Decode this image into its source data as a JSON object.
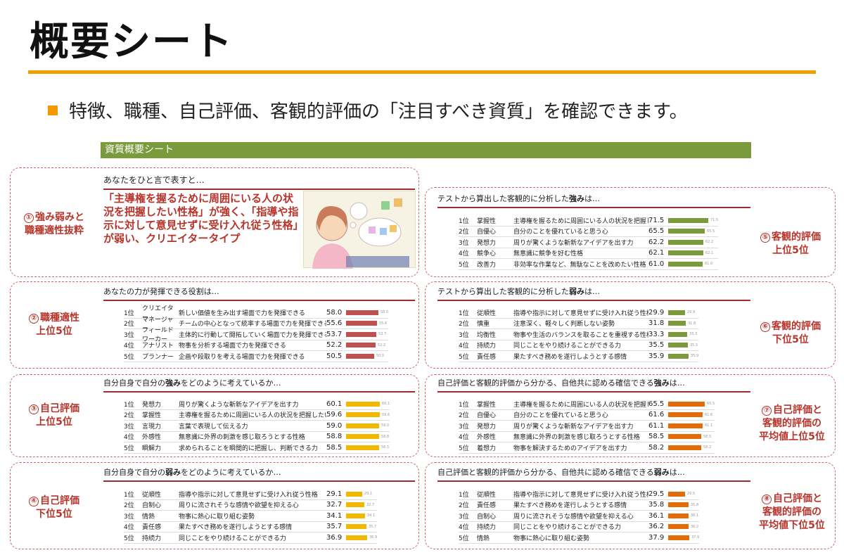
{
  "title": "概要シート",
  "bullet": "特徴、職種、自己評価、客観的評価の「注目すべき資質」を確認できます。",
  "banner": "資質概要シート",
  "colors": {
    "accent": "#f39800",
    "green": "#7a9a3c",
    "red_bar": "#c0504d",
    "yellow_bar": "#f2b800",
    "orange_bar": "#e36c0a",
    "label": "#b8342b"
  },
  "s1": {
    "num": "①",
    "label1": "強み弱みと",
    "label2": "職種適性抜粋",
    "heading": "あなたをひと言で表すと…",
    "quote": "「主導権を握るために周囲にいる人の状況を把握したい性格」が強く、「指導や指示に対して意見せずに受け入れ従う性格」が弱い、クリエイタータイプ",
    "illus_icon": "thinking-person-illustration"
  },
  "s2": {
    "num": "②",
    "label1": "職種適性",
    "label2": "上位5位",
    "heading": "あなたの力が発揮できる役割は…",
    "rows": [
      {
        "rank": "1位",
        "name": "クリエイター",
        "desc": "新しい価値を生み出す場面で力を発揮できる",
        "score": "58.0",
        "value": 58.0
      },
      {
        "rank": "2位",
        "name": "マネージャー",
        "desc": "チームの中心となって統率する場面で力を発揮できる",
        "score": "55.6",
        "value": 55.6
      },
      {
        "rank": "3位",
        "name": "フィールドワーカー",
        "desc": "主体的に行動して開拓していく場面で力を発揮できる",
        "score": "53.7",
        "value": 53.7
      },
      {
        "rank": "4位",
        "name": "アナリスト",
        "desc": "物事を分析する場面で力を発揮できる",
        "score": "52.2",
        "value": 52.2
      },
      {
        "rank": "5位",
        "name": "プランナー",
        "desc": "企画や段取りを考える場面で力を発揮できる",
        "score": "50.5",
        "value": 50.5
      }
    ]
  },
  "s3": {
    "num": "③",
    "label1": "自己評価",
    "label2": "上位5位",
    "heading_pre": "自分自身で自分の",
    "heading_em": "強み",
    "heading_post": "をどのように考えているか…",
    "rows": [
      {
        "rank": "1位",
        "name": "発想力",
        "desc": "周りが驚くような斬新なアイデアを出す力",
        "score": "60.1",
        "value": 60.1
      },
      {
        "rank": "2位",
        "name": "掌握性",
        "desc": "主導権を握るために周囲にいる人の状況を把握したい性格",
        "score": "59.6",
        "value": 59.6
      },
      {
        "rank": "3位",
        "name": "言現力",
        "desc": "言葉で表現して伝える力",
        "score": "59.0",
        "value": 59.0
      },
      {
        "rank": "4位",
        "name": "外感性",
        "desc": "無意識に外界の刺激を感じ取ろうとする性格",
        "score": "58.8",
        "value": 58.8
      },
      {
        "rank": "5位",
        "name": "瞬解力",
        "desc": "求められることを瞬間的に把握し、判断できる力",
        "score": "58.5",
        "value": 58.5
      }
    ]
  },
  "s4": {
    "num": "④",
    "label1": "自己評価",
    "label2": "下位5位",
    "heading_pre": "自分自身で自分の",
    "heading_em": "弱み",
    "heading_post": "をどのように考えているか…",
    "rows": [
      {
        "rank": "1位",
        "name": "従順性",
        "desc": "指導や指示に対して意見せずに受け入れ従う性格",
        "score": "29.1",
        "value": 29.1
      },
      {
        "rank": "2位",
        "name": "自制心",
        "desc": "周りに流されそうな感情や欲望を抑える心",
        "score": "32.7",
        "value": 32.7
      },
      {
        "rank": "3位",
        "name": "情熱",
        "desc": "物事に熱心に取り組む姿勢",
        "score": "34.1",
        "value": 34.1
      },
      {
        "rank": "4位",
        "name": "責任感",
        "desc": "果たすべき務めを遂行しようとする感情",
        "score": "35.7",
        "value": 35.7
      },
      {
        "rank": "5位",
        "name": "持続力",
        "desc": "同じことをやり続けることができる力",
        "score": "36.9",
        "value": 36.9
      }
    ]
  },
  "s5": {
    "num": "⑤",
    "label1": "客観的評価",
    "label2": "上位5位",
    "heading_pre": "テストから算出した客観的に分析した",
    "heading_em": "強み",
    "heading_post": "は…",
    "rows": [
      {
        "rank": "1位",
        "name": "掌握性",
        "desc": "主導権を握るために周囲にいる人の状況を把握したい性格",
        "score": "71.5",
        "value": 71.5
      },
      {
        "rank": "2位",
        "name": "自優心",
        "desc": "自分のことを優れていると思う心",
        "score": "65.5",
        "value": 65.5
      },
      {
        "rank": "3位",
        "name": "発想力",
        "desc": "周りが驚くような斬新なアイデアを出す力",
        "score": "62.2",
        "value": 62.2
      },
      {
        "rank": "4位",
        "name": "競争心",
        "desc": "無意識に競争を好む性格",
        "score": "62.1",
        "value": 62.1
      },
      {
        "rank": "5位",
        "name": "改善力",
        "desc": "非効率な作業など、無駄なことを改めたい性格",
        "score": "61.0",
        "value": 61.0
      }
    ]
  },
  "s6": {
    "num": "⑥",
    "label1": "客観的評価",
    "label2": "下位5位",
    "heading_pre": "テストから算出した客観的に分析した",
    "heading_em": "弱み",
    "heading_post": "は…",
    "rows": [
      {
        "rank": "1位",
        "name": "従順性",
        "desc": "指導や指示に対して意見せずに受け入れ従う性格",
        "score": "29.9",
        "value": 29.9
      },
      {
        "rank": "2位",
        "name": "慎重",
        "desc": "注意深く、軽々しく判断しない姿勢",
        "score": "31.8",
        "value": 31.8
      },
      {
        "rank": "3位",
        "name": "均衡性",
        "desc": "物事や生活のバランスを取ることを重視する性格",
        "score": "33.3",
        "value": 33.3
      },
      {
        "rank": "4位",
        "name": "持続力",
        "desc": "同じことをやり続けることができる力",
        "score": "35.5",
        "value": 35.5
      },
      {
        "rank": "5位",
        "name": "責任感",
        "desc": "果たすべき務めを遂行しようとする感情",
        "score": "35.9",
        "value": 35.9
      }
    ]
  },
  "s7": {
    "num": "⑦",
    "label1": "自己評価と",
    "label2": "客観的評価の",
    "label3": "平均値上位5位",
    "heading_pre": "自己評価と客観的評価から分かる、自他共に認める確信できる",
    "heading_em": "強み",
    "heading_post": "は…",
    "rows": [
      {
        "rank": "1位",
        "name": "掌握性",
        "desc": "主導権を握るために周囲にいる人の状況を把握したい性格",
        "score": "65.5",
        "value": 65.5
      },
      {
        "rank": "2位",
        "name": "自優心",
        "desc": "自分のことを優れていると思う心",
        "score": "61.6",
        "value": 61.6
      },
      {
        "rank": "3位",
        "name": "発想力",
        "desc": "周りが驚くような斬新なアイデアを出す力",
        "score": "61.1",
        "value": 61.1
      },
      {
        "rank": "4位",
        "name": "外感性",
        "desc": "無意識に外界の刺激を感じ取ろうとする性格",
        "score": "58.5",
        "value": 58.5
      },
      {
        "rank": "5位",
        "name": "着想力",
        "desc": "物事を解決するためのアイデアを出す力",
        "score": "58.2",
        "value": 58.2
      }
    ]
  },
  "s8": {
    "num": "⑧",
    "label1": "自己評価と",
    "label2": "客観的評価の",
    "label3": "平均値下位5位",
    "heading_pre": "自己評価と客観的評価から分かる、自他共に認める確信できる",
    "heading_em": "弱み",
    "heading_post": "は…",
    "rows": [
      {
        "rank": "1位",
        "name": "従順性",
        "desc": "指導や指示に対して意見せずに受け入れ従う性格",
        "score": "29.5",
        "value": 29.5
      },
      {
        "rank": "2位",
        "name": "責任感",
        "desc": "果たすべき務めを遂行しようとする感情",
        "score": "35.8",
        "value": 35.8
      },
      {
        "rank": "3位",
        "name": "自制心",
        "desc": "周りに流されそうな感情や欲望を抑える心",
        "score": "36.1",
        "value": 36.1
      },
      {
        "rank": "4位",
        "name": "持続力",
        "desc": "同じことをやり続けることができる力",
        "score": "36.2",
        "value": 36.2
      },
      {
        "rank": "5位",
        "name": "情熱",
        "desc": "物事に熱心に取り組む姿勢",
        "score": "37.9",
        "value": 37.9
      }
    ]
  }
}
